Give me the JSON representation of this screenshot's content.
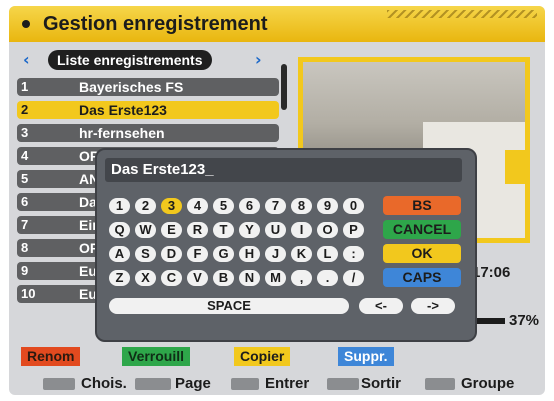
{
  "header": {
    "title": "Gestion enregistrement"
  },
  "list": {
    "tab_label": "Liste enregistrements",
    "rows": [
      {
        "num": "1",
        "name": "Bayerisches FS"
      },
      {
        "num": "2",
        "name": "Das Erste123",
        "selected": true
      },
      {
        "num": "3",
        "name": "hr-fernsehen"
      },
      {
        "num": "4",
        "name": "OR"
      },
      {
        "num": "5",
        "name": "AN"
      },
      {
        "num": "6",
        "name": "Da"
      },
      {
        "num": "7",
        "name": "Eir"
      },
      {
        "num": "8",
        "name": "OR"
      },
      {
        "num": "9",
        "name": "Eu"
      },
      {
        "num": "10",
        "name": "Eu"
      }
    ]
  },
  "status": {
    "time": "17:06",
    "percent": "37%"
  },
  "keyboard": {
    "input_value": "Das Erste123_",
    "row1": [
      "1",
      "2",
      "3",
      "4",
      "5",
      "6",
      "7",
      "8",
      "9",
      "0"
    ],
    "row2": [
      "Q",
      "W",
      "E",
      "R",
      "T",
      "Y",
      "U",
      "I",
      "O",
      "P"
    ],
    "row3": [
      "A",
      "S",
      "D",
      "F",
      "G",
      "H",
      "J",
      "K",
      "L",
      ":"
    ],
    "row4": [
      "Z",
      "X",
      "C",
      "V",
      "B",
      "N",
      "M",
      ",",
      ".",
      "/"
    ],
    "highlighted_key": "3",
    "space": "SPACE",
    "left": "<-",
    "right": "->",
    "bs": "BS",
    "cancel": "CANCEL",
    "ok": "OK",
    "caps": "CAPS"
  },
  "color_buttons": {
    "red": "Renom",
    "green": "Verrouill",
    "yellow": "Copier",
    "blue": "Suppr."
  },
  "hints": {
    "chois": "Chois.",
    "page": "Page",
    "entrer": "Entrer",
    "sortir": "Sortir",
    "groupe": "Groupe"
  },
  "colors": {
    "accent_yellow": "#f2c81d",
    "red": "#e24a1f",
    "green": "#2ea64a",
    "blue": "#3e86d8",
    "orange_bs": "#e9692a"
  }
}
